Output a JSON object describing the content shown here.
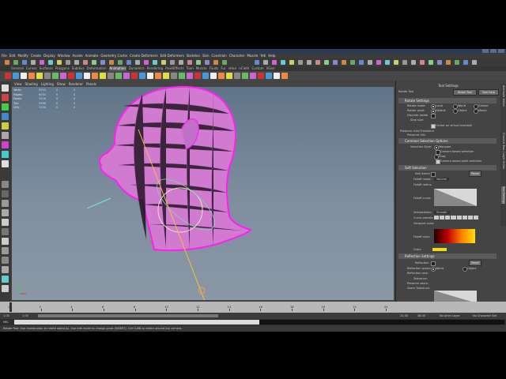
{
  "menubar": {
    "items": [
      "File",
      "Edit",
      "Modify",
      "Create",
      "Display",
      "Window",
      "Assets",
      "Animate",
      "Geometry Cache",
      "Create Deformers",
      "Edit Deformers",
      "Skeleton",
      "Skin",
      "Constrain",
      "Character",
      "Muscle",
      "Yeti",
      "Help"
    ]
  },
  "shelf": {
    "tabs": [
      "General",
      "Curves",
      "Surfaces",
      "Polygons",
      "Subdivs",
      "Deformation",
      "Animation",
      "Dynamics",
      "Rendering",
      "PaintEffects",
      "Toon",
      "Muscle",
      "Fluids",
      "Fur",
      "nHair",
      "nCloth",
      "Custom",
      "XGen"
    ],
    "active_tab": "Animation"
  },
  "viewport": {
    "panel_menu": [
      "View",
      "Shading",
      "Lighting",
      "Show",
      "Renderer",
      "Panels"
    ],
    "hud": [
      {
        "label": "Verts:",
        "a": "3010",
        "b": "0",
        "c": "0"
      },
      {
        "label": "Edges:",
        "a": "6034",
        "b": "0",
        "c": "0"
      },
      {
        "label": "Faces:",
        "a": "3016",
        "b": "0",
        "c": "0"
      },
      {
        "label": "Tris:",
        "a": "5998",
        "b": "0",
        "c": "0"
      },
      {
        "label": "UVs:",
        "a": "3134",
        "b": "0",
        "c": "0"
      }
    ]
  },
  "tool_settings": {
    "title": "Tool Settings",
    "tool_name": "Rotate Tool",
    "reset_label": "Reset Tool",
    "help_label": "Tool Help",
    "rotate_section": "Rotate Settings",
    "rotate_mode_label": "Rotate mode:",
    "rotate_modes": [
      "Local",
      "World",
      "Gimbal"
    ],
    "rotate_pivot_label": "Rotate pivot:",
    "pivot_modes": [
      "Default",
      "Object",
      "Manip"
    ],
    "discrete_label": "Discrete rotate",
    "steps_label": "Step size:",
    "center_label": "Center on virtual trackball",
    "preserve_label": "Preserve child Transform",
    "preserve_uvs_label": "Preserve UVs",
    "common_section": "Common Selection Options",
    "selection_style_label": "Selection Style:",
    "marquee_label": "Marquee",
    "camera_based_label": "Camera based selection",
    "drag_label": "Drag",
    "camera_paint_label": "Camera based paint selection",
    "soft_section": "Soft Selection",
    "soft_select_label": "Soft Select",
    "reset_small": "Reset",
    "falloff_mode_label": "Falloff mode:",
    "falloff_mode_value": "Volume",
    "falloff_radius_label": "Falloff radius:",
    "falloff_curve_label": "Falloff curve:",
    "interpolation_label": "Interpolation:",
    "interpolation_value": "Smooth",
    "curve_presets_label": "Curve presets:",
    "viewport_color_label": "Viewport color:",
    "falloff_color_label": "Falloff color:",
    "color_label": "Color:",
    "reflection_section": "Reflection Settings",
    "reflection_label": "Reflection",
    "reflection_space_label": "Reflection space:",
    "reflection_spaces": [
      "World",
      "Object"
    ],
    "reflection_axis_label": "Reflection axis:",
    "tolerance_label": "Tolerance:",
    "preserve_seam_label": "Preserve seam:",
    "seam_tolerance_label": "Seam Tolerance:"
  },
  "side_tabs": [
    "Attribute Editor",
    "Channel Box / Layer Editor",
    "Tool Settings"
  ],
  "time_slider": {
    "ticks": [
      "1",
      "2",
      "4",
      "6",
      "8",
      "10",
      "12",
      "14",
      "16",
      "18",
      "20",
      "22",
      "24"
    ],
    "start": "1.00",
    "end": "24.00",
    "range_start": "1.00",
    "range_end": "24.00",
    "anim_end": "48.00",
    "anim_layer": "No Anim Layer",
    "char_set": "No Character Set"
  },
  "cmd": {
    "label": "MEL"
  },
  "help_line": {
    "text": "Rotate Tool: Use manipulator to rotate object(s). Use edit mode to change pivot (INSERT). Ctrl+LMB to rotate around the camera."
  },
  "colors": {
    "mesh": "#e23ad6",
    "accent": "#f0d040",
    "bg": "#444444"
  }
}
